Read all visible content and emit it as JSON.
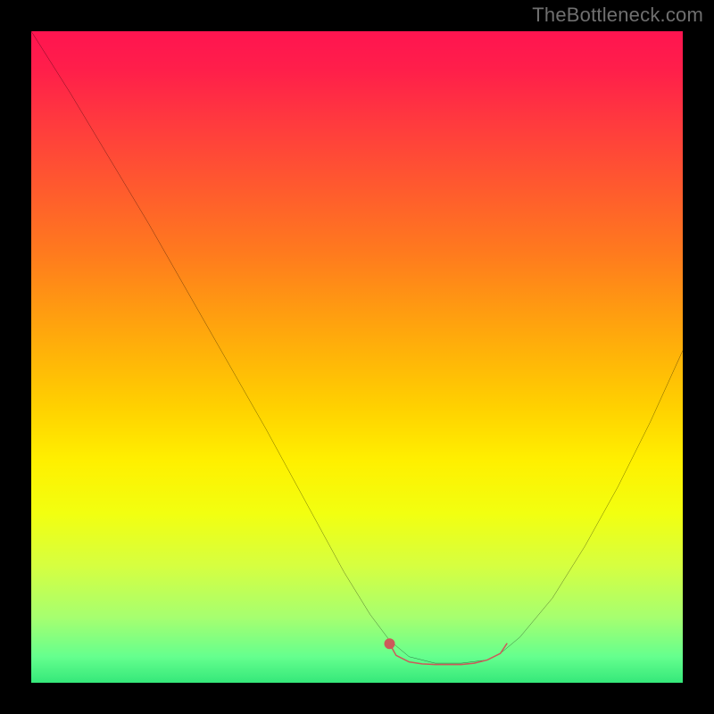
{
  "watermark": "TheBottleneck.com",
  "chart_data": {
    "type": "line",
    "title": "",
    "xlabel": "",
    "ylabel": "",
    "xlim": [
      0,
      100
    ],
    "ylim": [
      0,
      100
    ],
    "grid": false,
    "legend": false,
    "background_gradient": {
      "direction": "vertical",
      "stops": [
        {
          "pos": 0.0,
          "color": "#ff1450"
        },
        {
          "pos": 0.24,
          "color": "#ff5a2e"
        },
        {
          "pos": 0.5,
          "color": "#ffb508"
        },
        {
          "pos": 0.66,
          "color": "#fff000"
        },
        {
          "pos": 0.9,
          "color": "#a6ff70"
        },
        {
          "pos": 1.0,
          "color": "#35e87a"
        }
      ]
    },
    "series": [
      {
        "name": "bottleneck-curve",
        "color": "#000000",
        "x": [
          0,
          6,
          12,
          18,
          24,
          30,
          36,
          42,
          48,
          52,
          55,
          58,
          62,
          66,
          70,
          72,
          75,
          80,
          85,
          90,
          95,
          100
        ],
        "y": [
          100,
          90.5,
          80.5,
          70.5,
          60.0,
          49.5,
          39.0,
          28.0,
          17.0,
          10.5,
          6.5,
          4.0,
          3.0,
          3.0,
          3.5,
          4.5,
          7.0,
          13.0,
          21.0,
          30.0,
          40.0,
          51.0
        ]
      },
      {
        "name": "recommended-range",
        "color": "#cc5a5a",
        "x": [
          55,
          56,
          58,
          60,
          62,
          64,
          66,
          68,
          70,
          72,
          73
        ],
        "y": [
          6.0,
          4.2,
          3.2,
          2.9,
          2.8,
          2.8,
          2.8,
          3.0,
          3.5,
          4.5,
          6.0
        ]
      }
    ],
    "points": [
      {
        "name": "left-marker",
        "x": 55,
        "y": 6.0,
        "color": "#cc5a5a",
        "r": 4
      }
    ]
  },
  "colors": {
    "frame_background": "#000000",
    "curve": "#000000",
    "recommended": "#cc5a5a",
    "watermark": "#6f6f6f"
  }
}
